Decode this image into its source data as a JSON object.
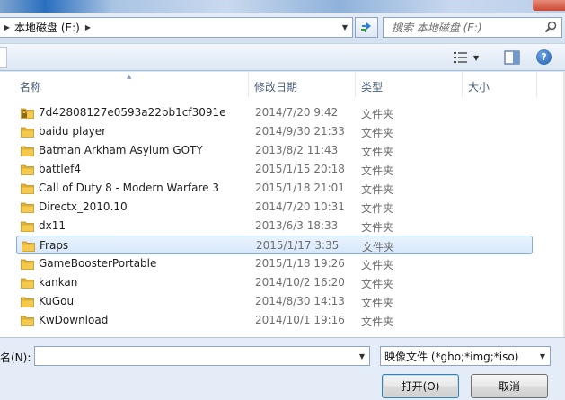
{
  "address": {
    "path": "本地磁盘 (E:)"
  },
  "search": {
    "placeholder": "搜索 本地磁盘 (E:)"
  },
  "columns": {
    "name": "名称",
    "modified": "修改日期",
    "type": "类型",
    "size": "大小"
  },
  "files": [
    {
      "name": "7d42808127e0593a22bb1cf3091e",
      "date": "2014/7/20 9:42",
      "type": "文件夹",
      "locked": true
    },
    {
      "name": "baidu player",
      "date": "2014/9/30 21:33",
      "type": "文件夹"
    },
    {
      "name": "Batman Arkham Asylum GOTY",
      "date": "2013/8/2 11:43",
      "type": "文件夹"
    },
    {
      "name": "battlef4",
      "date": "2015/1/15 20:18",
      "type": "文件夹"
    },
    {
      "name": "Call of Duty 8 - Modern Warfare 3",
      "date": "2015/1/18 21:01",
      "type": "文件夹"
    },
    {
      "name": "Directx_2010.10",
      "date": "2014/7/20 10:31",
      "type": "文件夹"
    },
    {
      "name": "dx11",
      "date": "2013/6/3 18:33",
      "type": "文件夹"
    },
    {
      "name": "Fraps",
      "date": "2015/1/17 3:35",
      "type": "文件夹",
      "selected": true
    },
    {
      "name": "GameBoosterPortable",
      "date": "2015/1/18 19:26",
      "type": "文件夹"
    },
    {
      "name": "kankan",
      "date": "2014/10/2 16:20",
      "type": "文件夹"
    },
    {
      "name": "KuGou",
      "date": "2014/8/30 14:13",
      "type": "文件夹"
    },
    {
      "name": "KwDownload",
      "date": "2014/10/1 19:16",
      "type": "文件夹"
    }
  ],
  "bottom": {
    "filename_label": "名(N):",
    "filename_value": "",
    "filetype": "映像文件 (*gho;*img;*iso)",
    "open_label": "打开(O)",
    "cancel_label": "取消"
  },
  "icons": {
    "folder": "folder-icon",
    "refresh": "refresh-icon",
    "search": "search-icon",
    "help": "help-icon",
    "view": "view-icon",
    "preview_pane": "preview-pane-icon"
  },
  "colors": {
    "selection_fill": "#d6e8fc",
    "selection_border": "#84acdd",
    "folder_yellow": "#f3c94e"
  }
}
